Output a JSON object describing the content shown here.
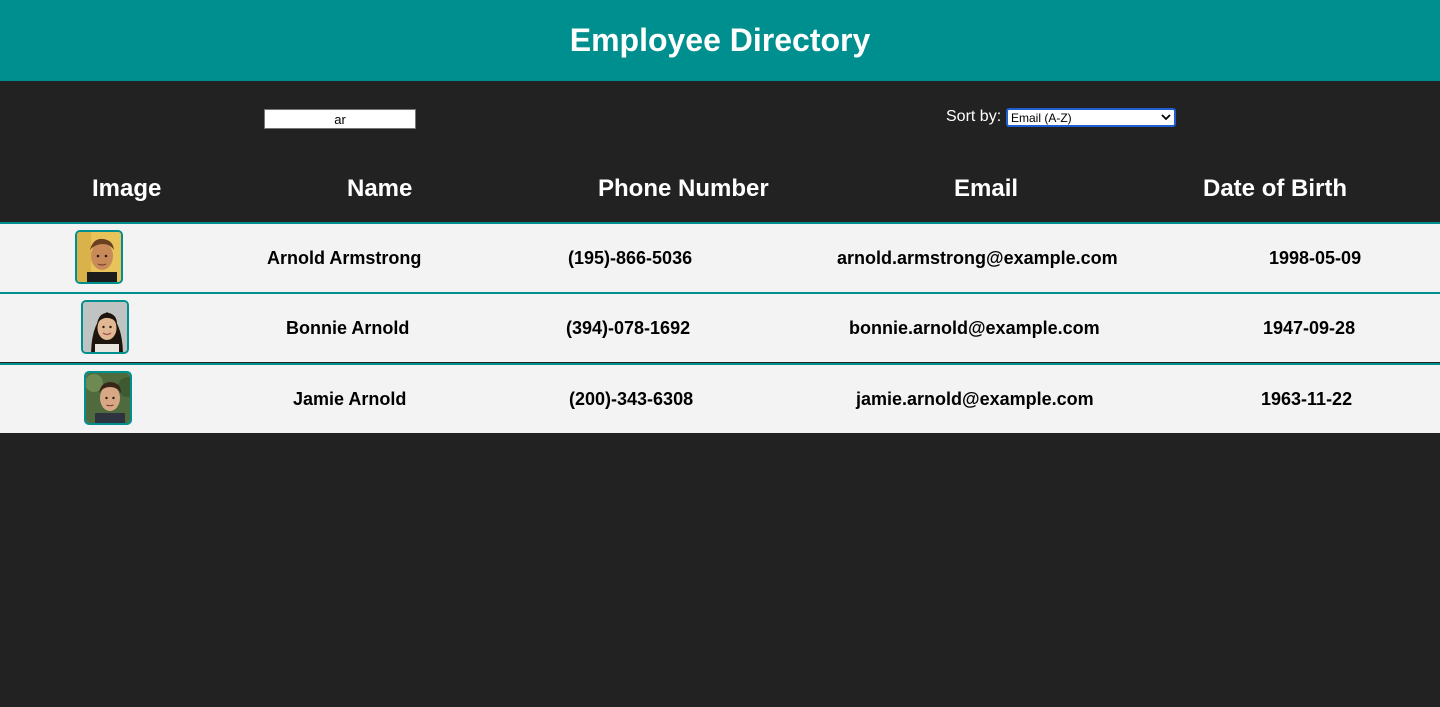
{
  "header": {
    "title": "Employee Directory"
  },
  "controls": {
    "search_value": "ar",
    "sort_label": "Sort by:",
    "sort_selected": "Email (A-Z)"
  },
  "table": {
    "columns": [
      "Image",
      "Name",
      "Phone Number",
      "Email",
      "Date of Birth"
    ],
    "rows": [
      {
        "name": "Arnold Armstrong",
        "phone": "(195)-866-5036",
        "email": "arnold.armstrong@example.com",
        "dob": "1998-05-09",
        "avatar": "avatar-photo-man"
      },
      {
        "name": "Bonnie Arnold",
        "phone": "(394)-078-1692",
        "email": "bonnie.arnold@example.com",
        "dob": "1947-09-28",
        "avatar": "avatar-photo-woman"
      },
      {
        "name": "Jamie Arnold",
        "phone": "(200)-343-6308",
        "email": "jamie.arnold@example.com",
        "dob": "1963-11-22",
        "avatar": "avatar-photo-man"
      }
    ]
  },
  "colors": {
    "accent": "#008f8f",
    "background": "#222222",
    "row_background": "#f3f3f3"
  }
}
